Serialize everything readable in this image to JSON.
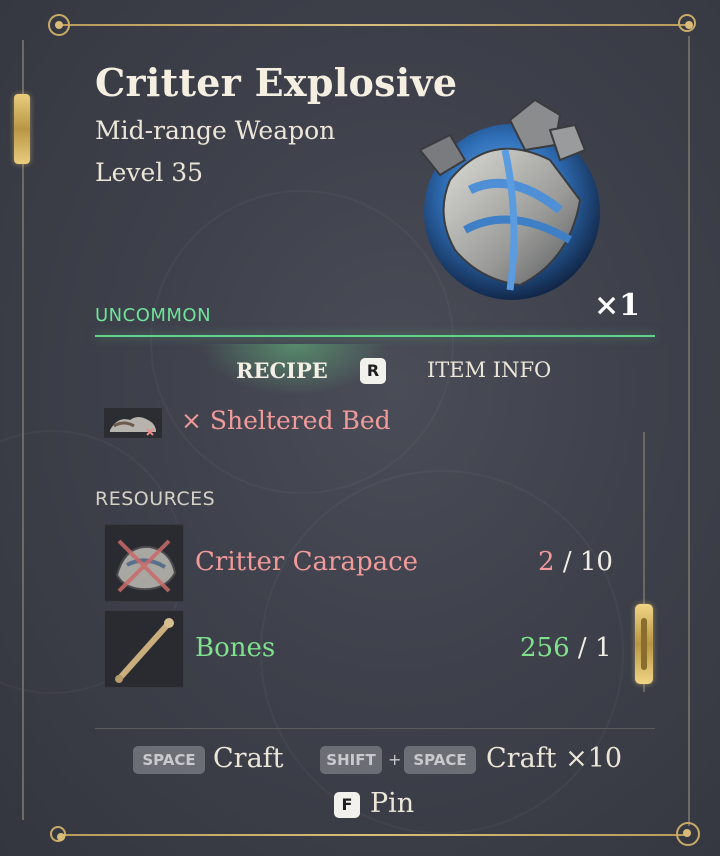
{
  "item": {
    "name": "Critter Explosive",
    "type": "Mid-range Weapon",
    "level": "Level 35",
    "rarity": "UNCOMMON",
    "quantity": "×1",
    "icon": "critter-explosive-icon"
  },
  "tabs": {
    "recipe": "RECIPE",
    "key_hint": "R",
    "item_info": "ITEM INFO"
  },
  "requirement": {
    "icon": "sheltered-bed-icon",
    "label": "× Sheltered Bed"
  },
  "resources": {
    "label": "RESOURCES",
    "items": [
      {
        "name": "Critter Carapace",
        "have": "2",
        "sep": "/",
        "need": "10",
        "icon": "critter-carapace-icon",
        "status_color": "#f09a9a"
      },
      {
        "name": "Bones",
        "have": "256",
        "sep": "/",
        "need": "1",
        "icon": "bones-icon",
        "status_color": "#7fe08e"
      }
    ]
  },
  "actions": {
    "craft_key": "SPACE",
    "craft_label": "Craft",
    "craft10_key_1": "SHIFT",
    "plus": "+",
    "craft10_key_2": "SPACE",
    "craft10_label": "Craft ×10",
    "pin_key": "F",
    "pin_label": "Pin"
  },
  "colors": {
    "rarity_uncommon": "#6fe39a",
    "missing": "#f09a9a",
    "sufficient": "#7fe08e",
    "frame_gold": "#c9ab68"
  }
}
